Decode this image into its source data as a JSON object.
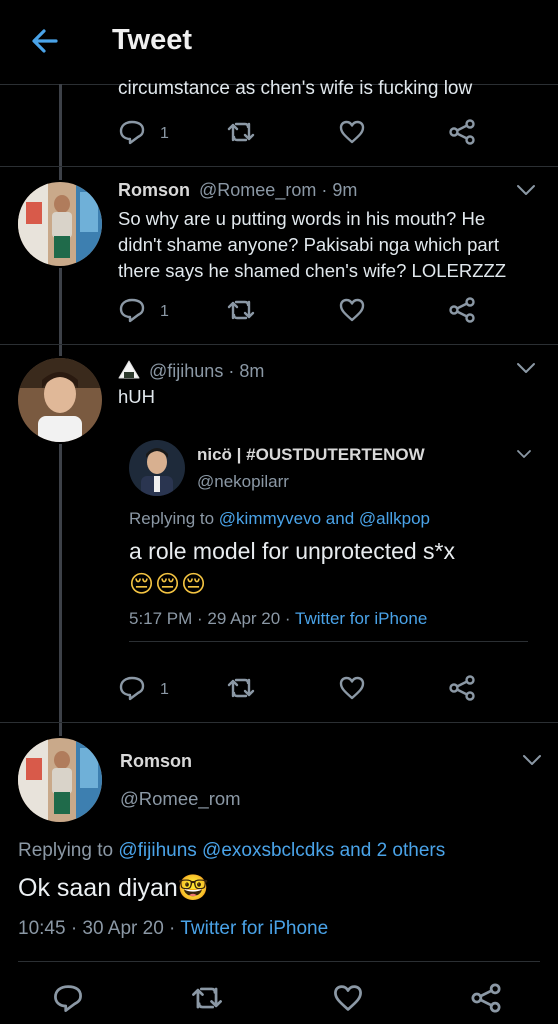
{
  "header": {
    "title": "Tweet"
  },
  "top_tweet": {
    "text_tail": "circumstance as chen's wife is fucking low",
    "reply_count": "1"
  },
  "tweet2": {
    "display_name": "Romson",
    "handle_time": "@Romee_rom · 9m",
    "lines": [
      "So why are u putting words in his mouth? He",
      "didn't shame anyone? Pakisabi nga which part",
      "there says he shamed chen's wife? LOLERZZZ"
    ],
    "reply_count": "1"
  },
  "tweet3": {
    "handle_time": "@fijihuns · 8m",
    "text": "hUH",
    "reply_count": "1",
    "quoted": {
      "display_name": "nicö | #OUSTDUTERTENOW",
      "handle": "@nekopilarr",
      "replying_prefix": "Replying to",
      "replying_to": "@kimmyvevo and @allkpop",
      "text": "a role model for unprotected s*x",
      "emojis": "😔😔😔",
      "timestamp": "5:17 PM · 29 Apr 20 ·",
      "source": "Twitter for iPhone"
    }
  },
  "main_tweet": {
    "display_name": "Romson",
    "handle": "@Romee_rom",
    "replying_prefix": "Replying to",
    "replying_to": "@fijihuns @exoxsbclcdks and 2 others",
    "text": "Ok saan diyan",
    "emoji": "🤓",
    "timestamp": "10:45 · 30 Apr 20 ·",
    "source": "Twitter for iPhone"
  },
  "colors": {
    "background": "#000000",
    "accent": "#4aa3e8",
    "muted": "#8b98a5",
    "text": "#e1e8ed"
  }
}
